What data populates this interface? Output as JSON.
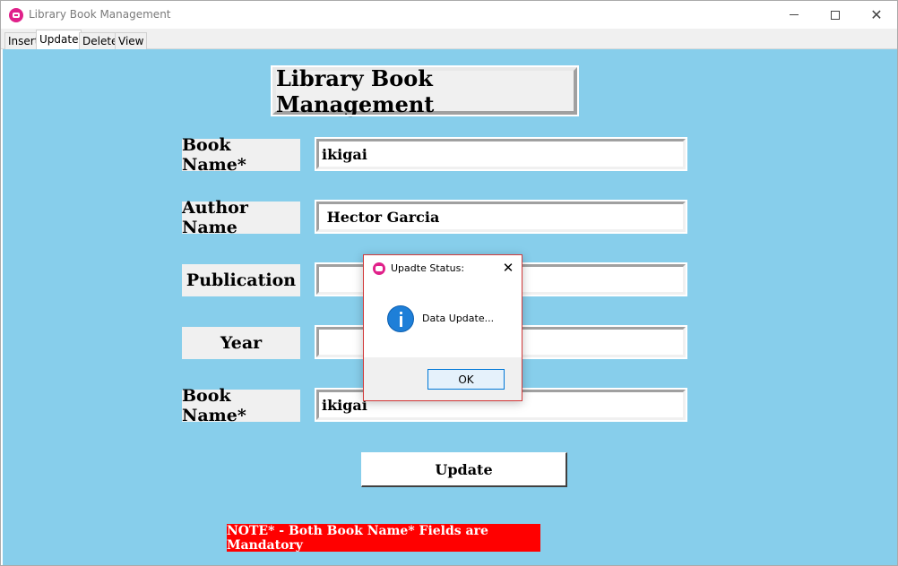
{
  "window": {
    "title": "Library Book Management",
    "controls": {
      "minimize": "minimize",
      "maximize": "maximize",
      "close": "✕"
    }
  },
  "tabs": [
    {
      "label": "Insert",
      "active": false
    },
    {
      "label": "Update",
      "active": true
    },
    {
      "label": "Delete",
      "active": false
    },
    {
      "label": "View",
      "active": false
    }
  ],
  "form": {
    "heading": "Library Book Management",
    "rows": [
      {
        "label": "Book Name*",
        "value": "ikigai"
      },
      {
        "label": "Author Name",
        "value": " Hector Garcia"
      },
      {
        "label": "Publication",
        "value": ""
      },
      {
        "label": "Year",
        "value": ""
      },
      {
        "label": "Book Name*",
        "value": "ikigai"
      }
    ],
    "update_button": "Update",
    "note": "NOTE* - Both Book Name* Fields are Mandatory"
  },
  "dialog": {
    "title": "Upadte Status:",
    "close": "✕",
    "message": "Data Update...",
    "ok_button": "OK",
    "icon": "info-icon"
  },
  "colors": {
    "background": "#87ceeb",
    "note_background": "#ff0000",
    "app_icon": "#e0218a",
    "info_icon": "#1e7fd8"
  }
}
